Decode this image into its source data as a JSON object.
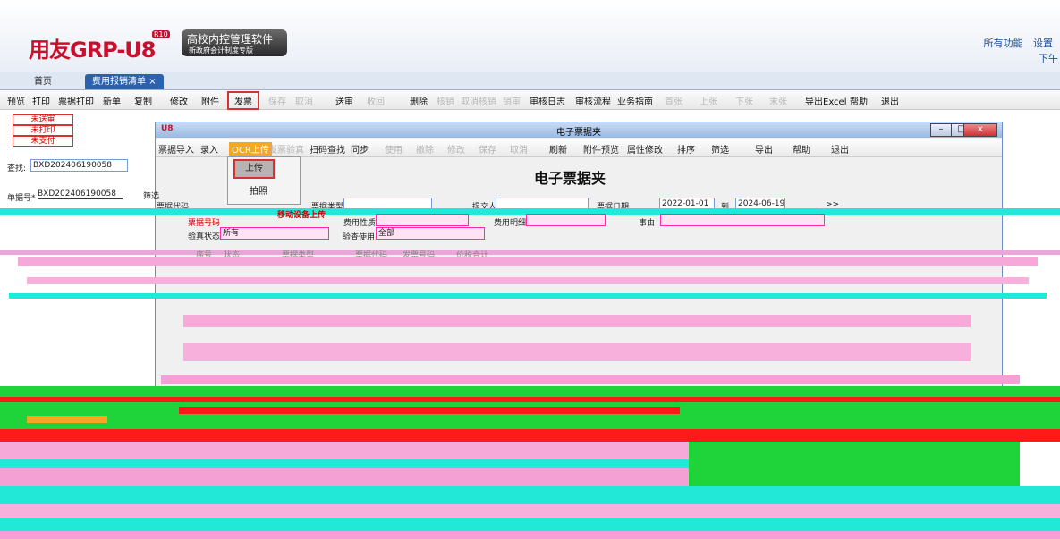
{
  "header": {
    "logo": "用友GRP-U8",
    "logo_badge": "R10",
    "product_title": "高校内控管理软件",
    "product_subtitle": "新政府会计制度专版",
    "links": [
      "所有功能",
      "设置"
    ],
    "sub_link": "下午"
  },
  "tabs": [
    {
      "label": "首页"
    },
    {
      "label": "费用报销清单"
    }
  ],
  "toolbar": {
    "items": [
      "预览",
      "打印",
      "票据打印",
      "新单",
      "复制",
      "修改",
      "附件",
      "发票",
      "保存",
      "取消",
      "送审",
      "收回",
      "删除",
      "核销",
      "取消核销",
      "销审",
      "审核日志",
      "审核流程",
      "业务指南",
      "首张",
      "上张",
      "下张",
      "末张",
      "导出Excel",
      "帮助",
      "退出"
    ]
  },
  "status_filters": [
    "未送审",
    "未打印",
    "未支付"
  ],
  "left_form": {
    "find_label": "查找:",
    "find_value": "BXD202406190058",
    "doc_label": "单据号*",
    "doc_value": "BXD202406190058"
  },
  "dialog": {
    "title": "电子票据夹",
    "toolbar": [
      "票据导入",
      "录入",
      "OCR上传",
      "发票验真",
      "扫码查找",
      "同步",
      "使用",
      "撤除",
      "修改",
      "保存",
      "取消",
      "刷新",
      "附件预览",
      "属性修改",
      "排序",
      "筛选",
      "导出",
      "帮助",
      "退出"
    ],
    "ocr_menu": [
      "上传",
      "拍照"
    ],
    "heading": "电子票据夹",
    "filter_label": "筛选",
    "fields": {
      "invoice_code_label": "票据代码",
      "invoice_type_label": "票据类型",
      "submitter_label": "提交人",
      "date_label": "票据日期",
      "date_from": "2022-01-01",
      "date_to_label": "到",
      "date_to": "2024-06-19",
      "more": ">>",
      "invoice_no_label": "票据号码",
      "mobile_upload": "移动设备上传",
      "expense_nature_label": "费用性质",
      "expense_detail_label": "费用明细",
      "reason_label": "事由",
      "verify_status_label": "验真状态",
      "verify_status_value": "所有",
      "verify_usage_label": "验查使用",
      "verify_usage_value": "全部"
    },
    "columns": [
      "序号",
      "状态",
      "票据类型",
      "票据代码",
      "发票号码",
      "价税合计"
    ]
  },
  "colors": {
    "accent": "#2a62b0",
    "highlight": "#d93030",
    "ocr": "#f5a623",
    "glitch_green": "#1fd33a",
    "glitch_red": "#ff1a1a",
    "glitch_pink": "#ff4fb8",
    "glitch_cyan": "#22e8d8"
  }
}
